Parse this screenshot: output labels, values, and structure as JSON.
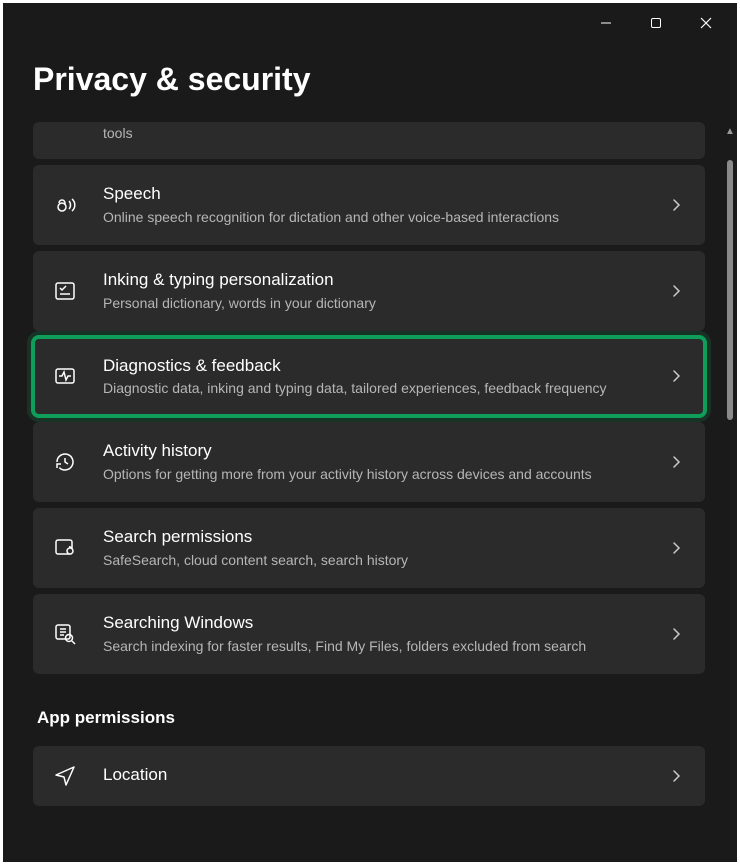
{
  "window": {
    "minimize": "Minimize",
    "maximize": "Maximize",
    "close": "Close"
  },
  "page": {
    "title": "Privacy & security"
  },
  "items": {
    "partial": {
      "sub": "tools"
    },
    "speech": {
      "title": "Speech",
      "sub": "Online speech recognition for dictation and other voice-based interactions"
    },
    "inking": {
      "title": "Inking & typing personalization",
      "sub": "Personal dictionary, words in your dictionary"
    },
    "diagnostics": {
      "title": "Diagnostics & feedback",
      "sub": "Diagnostic data, inking and typing data, tailored experiences, feedback frequency"
    },
    "activity": {
      "title": "Activity history",
      "sub": "Options for getting more from your activity history across devices and accounts"
    },
    "searchperm": {
      "title": "Search permissions",
      "sub": "SafeSearch, cloud content search, search history"
    },
    "searchwin": {
      "title": "Searching Windows",
      "sub": "Search indexing for faster results, Find My Files, folders excluded from search"
    },
    "location": {
      "title": "Location"
    }
  },
  "sections": {
    "app_permissions": "App permissions"
  },
  "highlight_color": "#0f9d5a"
}
